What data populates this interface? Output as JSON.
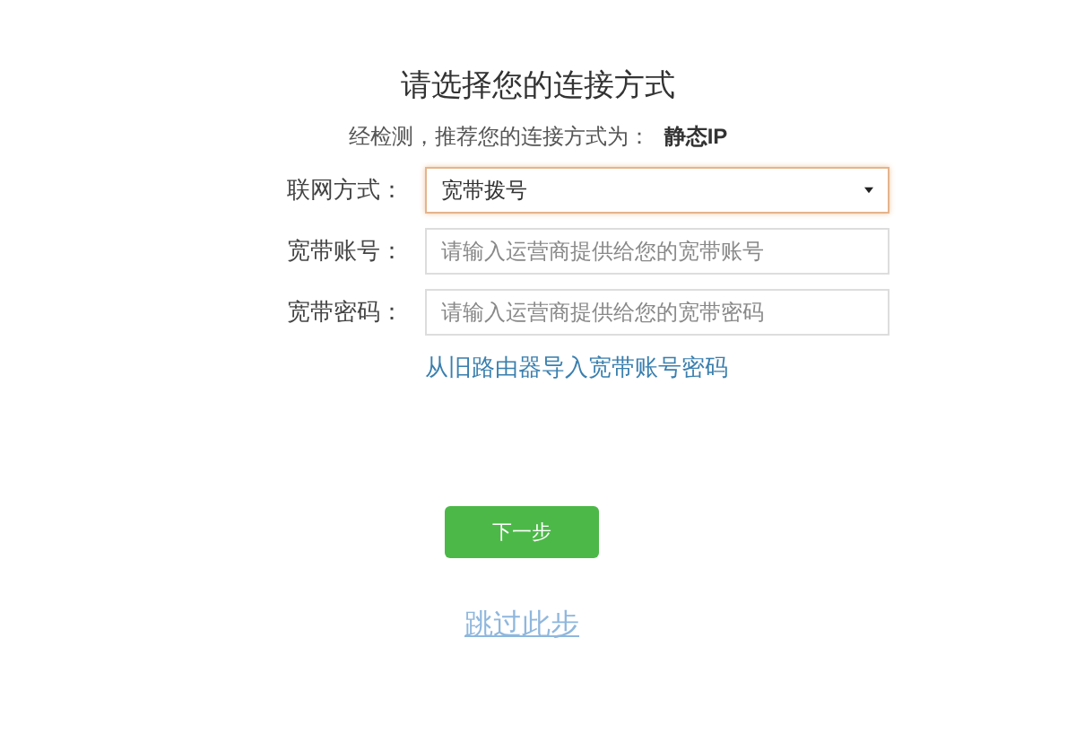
{
  "title": "请选择您的连接方式",
  "recommendation": {
    "text": "经检测，推荐您的连接方式为：",
    "value": "静态IP"
  },
  "fields": [
    {
      "kind": "select",
      "label": "联网方式：",
      "value": "宽带拨号",
      "focused": true
    },
    {
      "kind": "input",
      "label": "宽带账号：",
      "placeholder": "请输入运营商提供给您的宽带账号",
      "focused": false
    },
    {
      "kind": "input",
      "label": "宽带密码：",
      "placeholder": "请输入运营商提供给您的宽带密码",
      "focused": false
    }
  ],
  "import_link": "从旧路由器导入宽带账号密码",
  "next_button": "下一步",
  "skip_link": "跳过此步"
}
